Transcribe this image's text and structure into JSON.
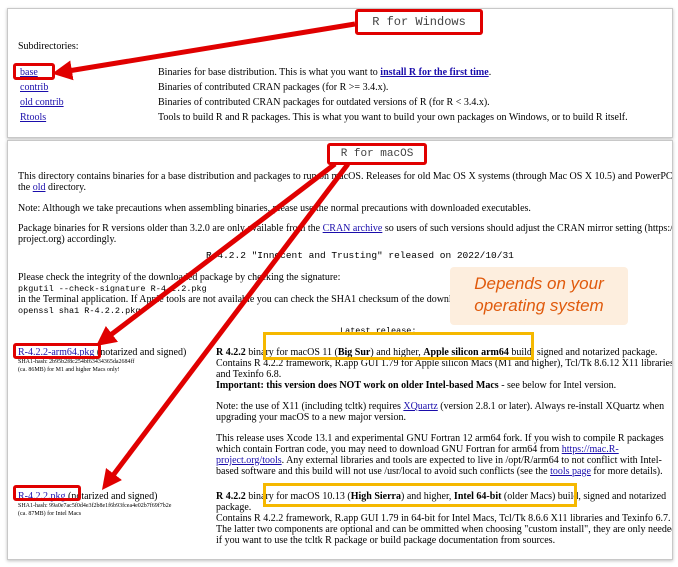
{
  "windows": {
    "title": "R for Windows",
    "subdirs_label": "Subdirectories:",
    "rows": [
      {
        "link": "base",
        "desc": "Binaries for base distribution. This is what you want to ",
        "desc_link": "install R for the first time",
        "desc_end": "."
      },
      {
        "link": "contrib",
        "desc": "Binaries of contributed CRAN packages (for R >= 3.4.x)."
      },
      {
        "link": "old contrib",
        "desc": "Binaries of contributed CRAN packages for outdated versions of R (for R < 3.4.x)."
      },
      {
        "link": "Rtools",
        "desc": "Tools to build R and R packages. This is what you want to build your own packages on Windows, or to build R itself."
      }
    ]
  },
  "mac": {
    "title": "R for macOS",
    "intro_1": "This directory contains binaries for a base distribution and packages to run on macOS. Releases for old Mac OS X systems (through Mac OS X 10.5) and PowerPC M",
    "intro_2a": "the ",
    "intro_2_link": "old",
    "intro_2b": " directory.",
    "note": "Note: Although we take precautions when assembling binaries, please use the normal precautions with downloaded executables.",
    "pkg_1a": "Package binaries for R versions older than 3.2.0 are only available from the ",
    "pkg_1_link": "CRAN archive",
    "pkg_1b": " so users of such versions should adjust the CRAN mirror setting (https://",
    "pkg_2": "project.org) accordingly.",
    "release": "R 4.2.2 \"Innocent and Trusting\" released on 2022/10/31",
    "integrity": "Please check the integrity of the downloaded package by checking the signature:",
    "cmd_1": "pkgutil --check-signature R-4.2.2.pkg",
    "integrity_2": "in the Terminal application. If Apple tools are not available you can check the SHA1 checksum of the downloaded",
    "cmd_2": "openssl sha1 R-4.2.2.pkg",
    "latest": "Latest release:",
    "arm": {
      "link": "R-4.2.2-arm64.pkg",
      "signed": " (notarized and signed)",
      "sha": "SHA1-hash: 2b95b2f8c254bf63434365da2684ff",
      "size": "(ca. 86MB) for M1 and higher Macs only!",
      "p1_bold": "R 4.2.2",
      "p1": " binary for macOS 11 (",
      "p1_b2": "Big Sur",
      "p1_c": ") and higher, ",
      "p1_b3": "Apple silicon arm64",
      "p1_d": " build, signed and notarized package.",
      "p1_line2": "Contains R 4.2.2 framework, R.app GUI 1.79 for Apple silicon Macs (M1 and higher), Tcl/Tk 8.6.12 X11 libraries",
      "p1_line3": "and Texinfo 6.8.",
      "important": "Important: this version does NOT work on older Intel-based Macs",
      "important_tail": " - see below for Intel version.",
      "x11_1": "Note: the use of X11 (including tcltk) requires ",
      "x11_link": "XQuartz",
      "x11_2": " (version 2.8.1 or later). Always re-install XQuartz when",
      "x11_3": "upgrading your macOS to a new major version.",
      "xcode_1": "This release uses Xcode 13.1 and experimental GNU Fortran 12 arm64 fork. If you wish to compile R packages",
      "xcode_2a": "which contain Fortran code, you may need to download GNU Fortran for arm64 from ",
      "xcode_2_link": "https://mac.R-",
      "xcode_3_link": "project.org/tools",
      "xcode_3": ". Any external libraries and tools are expected to live in /opt/R/arm64 to not conflict with Intel-",
      "xcode_4a": "based software and this build will not use /usr/local to avoid such conflicts (see the ",
      "xcode_4_link": "tools page",
      "xcode_4b": " for more details)."
    },
    "intel": {
      "link": "R-4.2.2.pkg",
      "signed": " (notarized and signed)",
      "sha": "SHA1-hash: 99a0e7ac5f0d4e3f2b8e1f6b93fcea4e02b7f69f7b2e",
      "size": "(ca. 87MB) for Intel Macs",
      "p_bold": "R 4.2.2",
      "p": " binary for macOS 10.13 (",
      "p_b2": "High Sierra",
      "p_c": ") and higher, ",
      "p_b3": "Intel 64-bit",
      "p_d": " (older Macs) build, signed and notarized",
      "p_line2": "package.",
      "p_line3": "Contains R 4.2.2 framework, R.app GUI 1.79 in 64-bit for Intel Macs, Tcl/Tk 8.6.6 X11 libraries and Texinfo 6.7.",
      "p_line4": "The latter two components are optional and can be ommitted when choosing \"custom install\", they are only needed",
      "p_line5": "if you want to use the tcltk R package or build package documentation from sources."
    }
  },
  "callout": {
    "line1": "Depends on your",
    "line2": "operating system"
  },
  "colors": {
    "annotation_red": "#e00000",
    "highlight_yellow": "#f5b800",
    "callout_text": "#e05a0c",
    "callout_bg": "#fdeede",
    "link": "#1a0dab"
  }
}
